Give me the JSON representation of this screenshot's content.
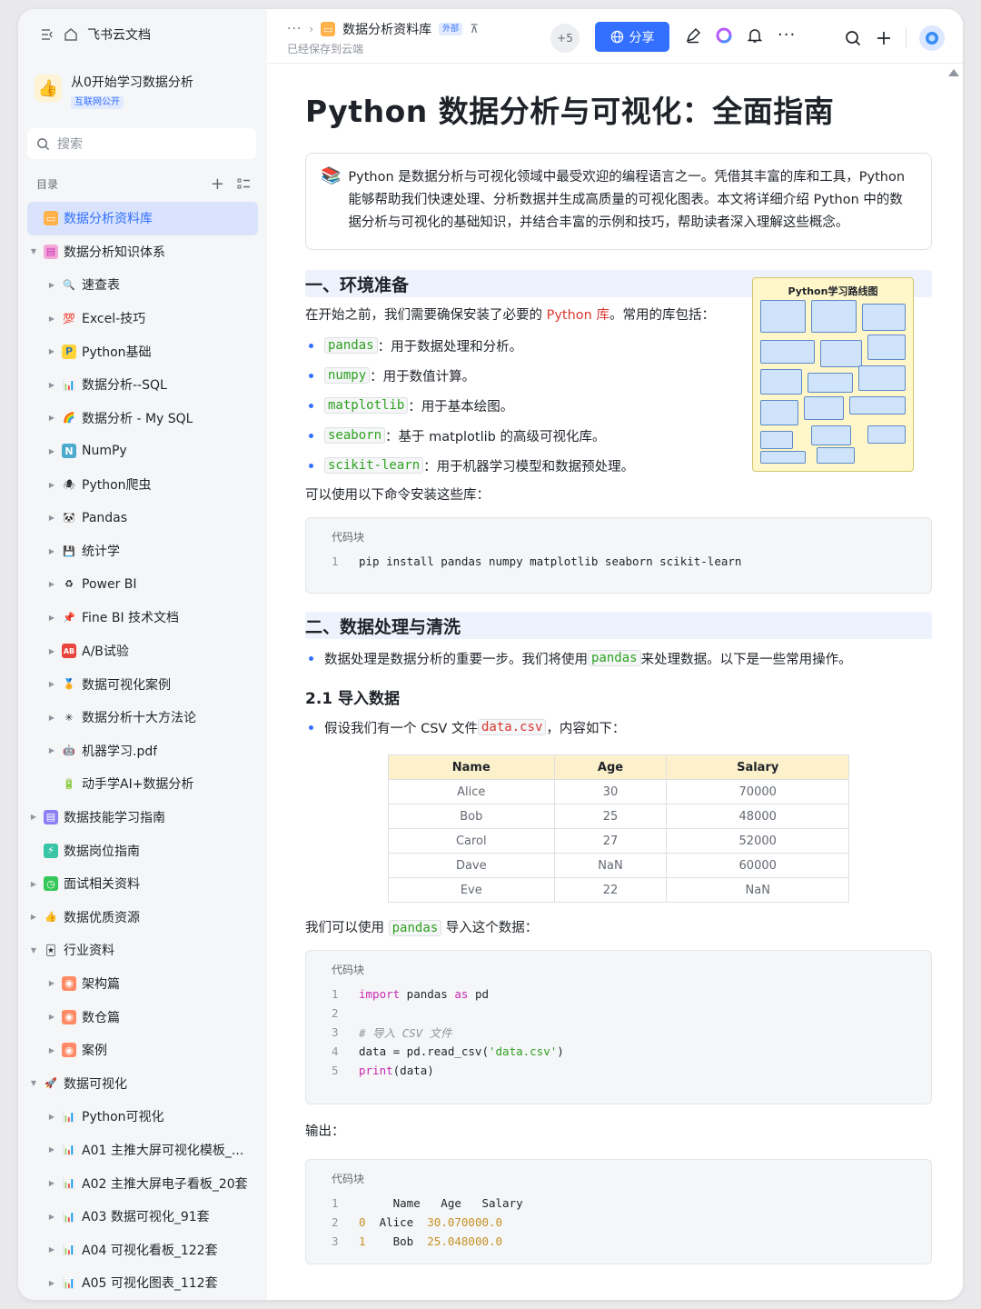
{
  "app": {
    "name": "飞书云文档"
  },
  "space": {
    "title": "从0开始学习数据分析",
    "tag": "互联网公开"
  },
  "search": {
    "placeholder": "搜索"
  },
  "toc": {
    "label": "目录"
  },
  "sidebar": {
    "items": [
      {
        "label": "数据分析资料库",
        "icon": "folder-orange-icon",
        "level": 0,
        "active": true
      },
      {
        "label": "数据分析知识体系",
        "icon": "book-pink-icon",
        "level": 0,
        "expanded": true
      },
      {
        "label": "速查表",
        "icon": "magnifier-icon",
        "level": 1
      },
      {
        "label": "Excel-技巧",
        "icon": "100-emoji-icon",
        "level": 1
      },
      {
        "label": "Python基础",
        "icon": "python-icon",
        "level": 1
      },
      {
        "label": "数据分析--SQL",
        "icon": "bar-chart-icon",
        "level": 1
      },
      {
        "label": "数据分析 - My SQL",
        "icon": "rainbow-icon",
        "level": 1
      },
      {
        "label": "NumPy",
        "icon": "numpy-icon",
        "level": 1
      },
      {
        "label": "Python爬虫",
        "icon": "spider-icon",
        "level": 1
      },
      {
        "label": "Pandas",
        "icon": "panda-icon",
        "level": 1
      },
      {
        "label": "统计学",
        "icon": "floppy-icon",
        "level": 1
      },
      {
        "label": "Power BI",
        "icon": "recycle-icon",
        "level": 1
      },
      {
        "label": "Fine BI 技术文档",
        "icon": "pin-icon",
        "level": 1
      },
      {
        "label": "A/B试验",
        "icon": "ab-icon",
        "level": 1
      },
      {
        "label": "数据可视化案例",
        "icon": "medal-icon",
        "level": 1
      },
      {
        "label": "数据分析十大方法论",
        "icon": "sparkle-icon",
        "level": 1
      },
      {
        "label": "机器学习.pdf",
        "icon": "robot-icon",
        "level": 1
      },
      {
        "label": "动手学AI+数据分析",
        "icon": "battery-icon",
        "level": 1,
        "leaf": true
      },
      {
        "label": "数据技能学习指南",
        "icon": "purple-doc-icon",
        "level": 0
      },
      {
        "label": "数据岗位指南",
        "icon": "teal-doc-icon",
        "level": 0,
        "leaf": true
      },
      {
        "label": "面试相关资料",
        "icon": "green-doc-icon",
        "level": 0
      },
      {
        "label": "数据优质资源",
        "icon": "thumbs-up-icon",
        "level": 0
      },
      {
        "label": "行业资料",
        "icon": "cards-icon",
        "level": 0,
        "expanded": true
      },
      {
        "label": "架构篇",
        "icon": "orange-dot-icon",
        "level": 1
      },
      {
        "label": "数仓篇",
        "icon": "orange-dot-icon",
        "level": 1
      },
      {
        "label": "案例",
        "icon": "orange-dot-icon",
        "level": 1
      },
      {
        "label": "数据可视化",
        "icon": "rocket-icon",
        "level": 0,
        "expanded": true
      },
      {
        "label": "Python可视化",
        "icon": "bar-chart-icon",
        "level": 1
      },
      {
        "label": "A01 主推大屏可视化模板_...",
        "icon": "bar-chart-icon",
        "level": 1
      },
      {
        "label": "A02 主推大屏电子看板_20套",
        "icon": "bar-chart-icon",
        "level": 1
      },
      {
        "label": "A03 数据可视化_91套",
        "icon": "bar-chart-icon",
        "level": 1
      },
      {
        "label": "A04 可视化看板_122套",
        "icon": "bar-chart-icon",
        "level": 1
      },
      {
        "label": "A05 可视化图表_112套",
        "icon": "bar-chart-icon",
        "level": 1
      }
    ]
  },
  "topbar": {
    "breadcrumb_doc": "数据分析资料库",
    "external_badge": "外部",
    "saved": "已经保存到云端",
    "collaborators": "+5",
    "share": "分享"
  },
  "doc": {
    "title": "Python 数据分析与可视化：全面指南",
    "callout": "Python 是数据分析与可视化领域中最受欢迎的编程语言之一。凭借其丰富的库和工具，Python 能够帮助我们快速处理、分析数据并生成高质量的可视化图表。本文将详细介绍 Python 中的数据分析与可视化的基础知识，并结合丰富的示例和技巧，帮助读者深入理解这些概念。",
    "s1": {
      "heading": "一、环境准备",
      "intro_a": "在开始之前，我们需要确保安装了必要的 ",
      "intro_link": "Python 库",
      "intro_b": "。常用的库包括：",
      "libs": [
        {
          "code": "pandas",
          "desc": "：用于数据处理和分析。"
        },
        {
          "code": "numpy",
          "desc": "：用于数值计算。"
        },
        {
          "code": "matplotlib",
          "desc": "：用于基本绘图。"
        },
        {
          "code": "seaborn",
          "desc": "：基于 matplotlib 的高级可视化库。"
        },
        {
          "code": "scikit-learn",
          "desc": "：用于机器学习模型和数据预处理。"
        }
      ],
      "install_text": "可以使用以下命令安装这些库：",
      "code_label": "代码块",
      "code": [
        "pip install pandas numpy matplotlib seaborn scikit-learn"
      ],
      "roadmap_title": "Python学习路线图"
    },
    "s2": {
      "heading": "二、数据处理与清洗",
      "bullet_a": "数据处理是数据分析的重要一步。我们将使用 ",
      "bullet_code": "pandas",
      "bullet_b": " 来处理数据。以下是一些常用操作。",
      "sub": "2.1 导入数据",
      "csv_a": "假设我们有一个 CSV 文件 ",
      "csv_code": "data.csv",
      "csv_b": "，内容如下：",
      "table": {
        "headers": [
          "Name",
          "Age",
          "Salary"
        ],
        "rows": [
          [
            "Alice",
            "30",
            "70000"
          ],
          [
            "Bob",
            "25",
            "48000"
          ],
          [
            "Carol",
            "27",
            "52000"
          ],
          [
            "Dave",
            "NaN",
            "60000"
          ],
          [
            "Eve",
            "22",
            "NaN"
          ]
        ]
      },
      "import_a": "我们可以使用 ",
      "import_code": "pandas",
      "import_b": " 导入这个数据：",
      "code_label": "代码块",
      "output_label": "输出：",
      "output_code_label": "代码块"
    }
  },
  "colors": {
    "accent": "#3370ff",
    "code_green": "#2ea121",
    "link_red": "#d83931",
    "table_header": "#fdf1cc"
  }
}
